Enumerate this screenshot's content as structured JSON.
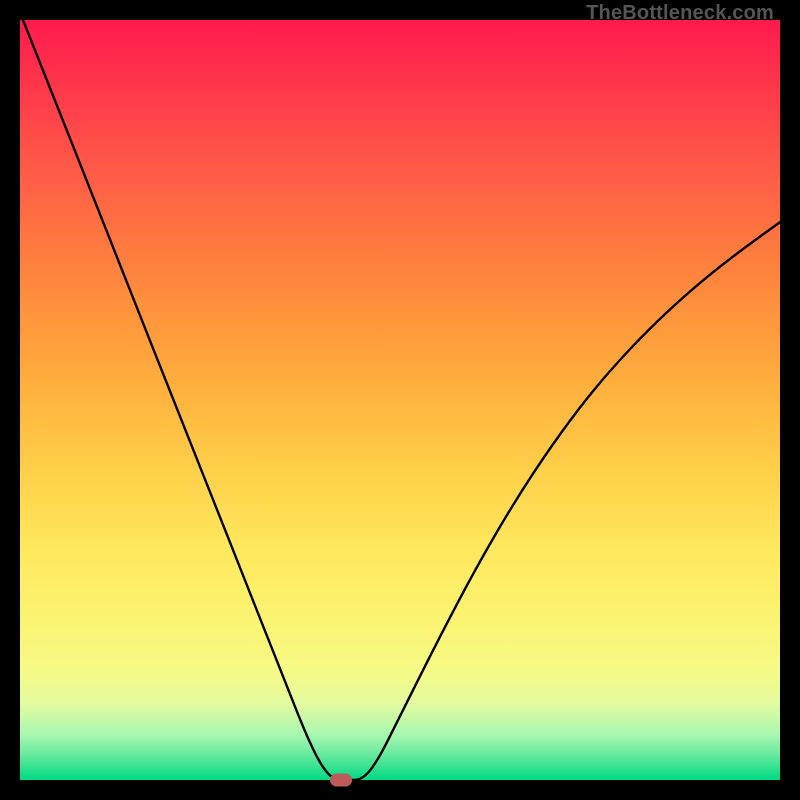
{
  "watermark": "TheBottleneck.com",
  "colors": {
    "frame": "#000000",
    "curve": "#000000",
    "marker": "#bd5b5b"
  },
  "chart_data": {
    "type": "line",
    "title": "",
    "xlabel": "",
    "ylabel": "",
    "xlim": [
      0,
      100
    ],
    "ylim": [
      0,
      100
    ],
    "grid": false,
    "annotations": [
      {
        "text": "TheBottleneck.com",
        "position": "top-right"
      }
    ],
    "series": [
      {
        "name": "curve",
        "x": [
          0,
          5,
          10,
          15,
          20,
          25,
          30,
          35,
          38,
          40,
          41.5,
          43,
          45,
          47,
          50,
          55,
          60,
          65,
          70,
          75,
          80,
          85,
          90,
          95,
          100
        ],
        "y": [
          101,
          88.4,
          75.8,
          63.1,
          50.5,
          37.9,
          25.3,
          12.6,
          5.1,
          1.3,
          0.0,
          0.0,
          0.0,
          2.4,
          8.4,
          18.4,
          27.9,
          36.5,
          44.1,
          50.8,
          56.5,
          61.5,
          65.9,
          69.8,
          73.4
        ]
      }
    ],
    "markers": [
      {
        "name": "optimum",
        "x": 42.2,
        "y": 0.0
      }
    ],
    "background_gradient_stops": [
      {
        "pos": 0.0,
        "color": "#ff1a4d"
      },
      {
        "pos": 0.5,
        "color": "#ffb53f"
      },
      {
        "pos": 0.8,
        "color": "#f6fb88"
      },
      {
        "pos": 1.0,
        "color": "#00db84"
      }
    ]
  }
}
